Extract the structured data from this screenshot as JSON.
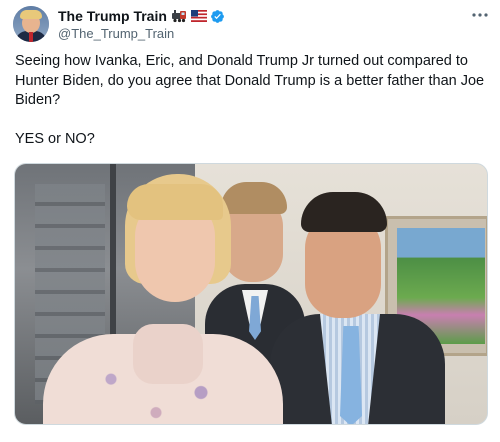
{
  "account": {
    "display_name": "The Trump Train",
    "handle": "@The_Trump_Train",
    "avatar_icon": "avatar-portrait",
    "verified_icon": "verified-badge-icon",
    "emoji_icons": [
      "train-emoji-icon",
      "us-flag-emoji-icon"
    ]
  },
  "tweet": {
    "text": "Seeing how Ivanka, Eric, and Donald Trump Jr turned out compared to Hunter Biden, do you agree that Donald Trump is a better father than Joe Biden?\n\nYES or NO?",
    "more_icon": "more-options-icon"
  },
  "colors": {
    "verified_blue": "#1d9bf0",
    "text_primary": "#0f1419",
    "text_secondary": "#536471",
    "border": "#cfd9de"
  }
}
